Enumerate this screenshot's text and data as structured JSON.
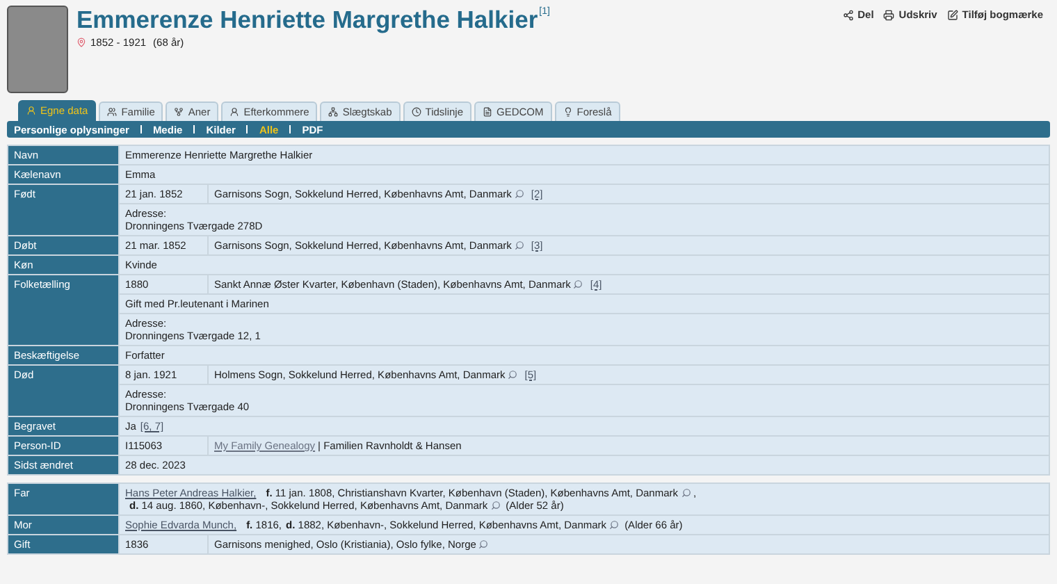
{
  "person": {
    "name": "Emmerenze Henriette Margrethe Halkier",
    "note": "[1]",
    "years": "1852 - 1921",
    "age": "(68 år)"
  },
  "actions": [
    {
      "kind": "share",
      "label": "Del"
    },
    {
      "kind": "print",
      "label": "Udskriv"
    },
    {
      "kind": "bookmark",
      "label": "Tilføj bogmærke"
    }
  ],
  "tabs": [
    {
      "kind": "person",
      "label": "Egne data",
      "selected": true
    },
    {
      "kind": "family",
      "label": "Familie",
      "selected": false
    },
    {
      "kind": "ancestors",
      "label": "Aner",
      "selected": false
    },
    {
      "kind": "descendants",
      "label": "Efterkommere",
      "selected": false
    },
    {
      "kind": "relation",
      "label": "Slægtskab",
      "selected": false
    },
    {
      "kind": "timeline",
      "label": "Tidslinje",
      "selected": false
    },
    {
      "kind": "gedcom",
      "label": "GEDCOM",
      "selected": false
    },
    {
      "kind": "suggest",
      "label": "Foreslå",
      "selected": false
    }
  ],
  "subnav": [
    {
      "label": "Personlige oplysninger",
      "selected": false
    },
    {
      "label": "Medie",
      "selected": false
    },
    {
      "label": "Kilder",
      "selected": false
    },
    {
      "label": "Alle",
      "selected": true
    },
    {
      "label": "PDF",
      "selected": false
    }
  ],
  "facts": [
    {
      "label": "Navn",
      "lines": [
        {
          "kind": "text",
          "text": "Emmerenze Henriette Margrethe Halkier"
        }
      ]
    },
    {
      "label": "Kælenavn",
      "lines": [
        {
          "kind": "text",
          "text": "Emma"
        }
      ]
    },
    {
      "label": "Født",
      "lines": [
        {
          "kind": "event",
          "date": "21 jan. 1852",
          "place": "Garnisons Sogn, Sokkelund Herred, Københavns Amt, Danmark",
          "source": "[2]"
        },
        {
          "kind": "address",
          "heading": "Adresse:",
          "text": "Dronningens Tværgade 278D"
        }
      ]
    },
    {
      "label": "Døbt",
      "lines": [
        {
          "kind": "event",
          "date": "21 mar. 1852",
          "place": "Garnisons Sogn, Sokkelund Herred, Københavns Amt, Danmark",
          "source": "[3]"
        }
      ]
    },
    {
      "label": "Køn",
      "lines": [
        {
          "kind": "text",
          "text": "Kvinde"
        }
      ]
    },
    {
      "label": "Folketælling",
      "lines": [
        {
          "kind": "event",
          "date": "1880",
          "place": "Sankt Annæ Øster Kvarter, København (Staden), Københavns Amt, Danmark",
          "source": "[4]"
        },
        {
          "kind": "text",
          "text": "Gift med Pr.leutenant i Marinen"
        },
        {
          "kind": "address",
          "heading": "Adresse:",
          "text": "Dronningens Tværgade 12, 1"
        }
      ]
    },
    {
      "label": "Beskæftigelse",
      "lines": [
        {
          "kind": "text",
          "text": "Forfatter"
        }
      ]
    },
    {
      "label": "Død",
      "lines": [
        {
          "kind": "event",
          "date": "8 jan. 1921",
          "place": "Holmens Sogn, Sokkelund Herred, Københavns Amt, Danmark",
          "source": "[5]"
        },
        {
          "kind": "address",
          "heading": "Adresse:",
          "text": "Dronningens Tværgade 40"
        }
      ]
    },
    {
      "label": "Begravet",
      "lines": [
        {
          "kind": "sourced",
          "text": "Ja",
          "source": "[6, 7]"
        }
      ]
    },
    {
      "label": "Person-ID",
      "lines": [
        {
          "kind": "id",
          "id": "I115063",
          "link": "My Family Genealogy",
          "text": "| Familien Ravnholdt & Hansen"
        }
      ]
    },
    {
      "label": "Sidst ændret",
      "lines": [
        {
          "kind": "text",
          "text": "28 dec. 2023"
        }
      ]
    }
  ],
  "family": [
    {
      "label": "Far",
      "kind": "parent",
      "link": "Hans Peter Andreas Halkier,",
      "events": [
        {
          "text": "**f.** 11 jan. 1808, Christianshavn Kvarter, København (Staden), Københavns Amt, Danmark",
          "pin": true,
          "suffix": ","
        },
        {
          "text": "**d.** 14 aug. 1860, København-, Sokkelund Herred, Københavns Amt, Danmark",
          "pin": true
        }
      ],
      "age": "(Alder 52 år)"
    },
    {
      "label": "Mor",
      "kind": "parent",
      "link": "Sophie Edvarda Munch,",
      "events": [
        {
          "text": "**f.** 1816,",
          "pin": false
        },
        {
          "text": "**d.** 1882, København-, Sokkelund Herred, Københavns Amt, Danmark",
          "pin": true
        }
      ],
      "age": "(Alder 66 år)"
    },
    {
      "label": "Gift",
      "kind": "event",
      "date": "1836",
      "place": "Garnisons menighed, Oslo (Kristiania), Oslo fylke, Norge"
    }
  ]
}
